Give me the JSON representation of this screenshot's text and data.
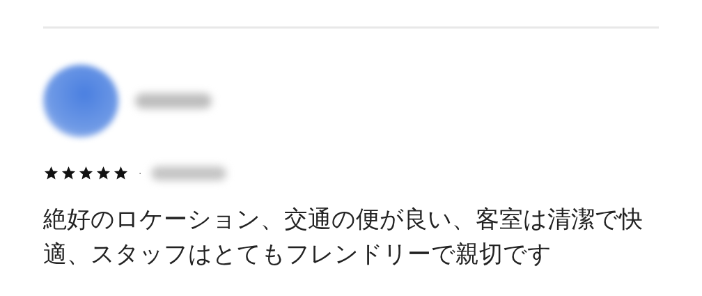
{
  "review": {
    "stars": 5,
    "separator": "·",
    "text": "絶好のロケーション、交通の便が良い、客室は清潔で快適、スタッフはとてもフレンドリーで親切です"
  }
}
